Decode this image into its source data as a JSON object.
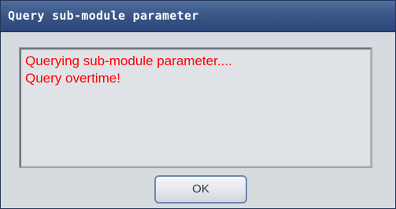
{
  "dialog": {
    "title": "Query sub-module parameter",
    "messages": [
      "Querying sub-module parameter....",
      "Query overtime!"
    ],
    "ok_label": "OK"
  },
  "colors": {
    "titlebar": "#3a5788",
    "title_text": "#ffffff",
    "dialog_background": "#d6dbe0",
    "message_text": "#ff0000"
  }
}
